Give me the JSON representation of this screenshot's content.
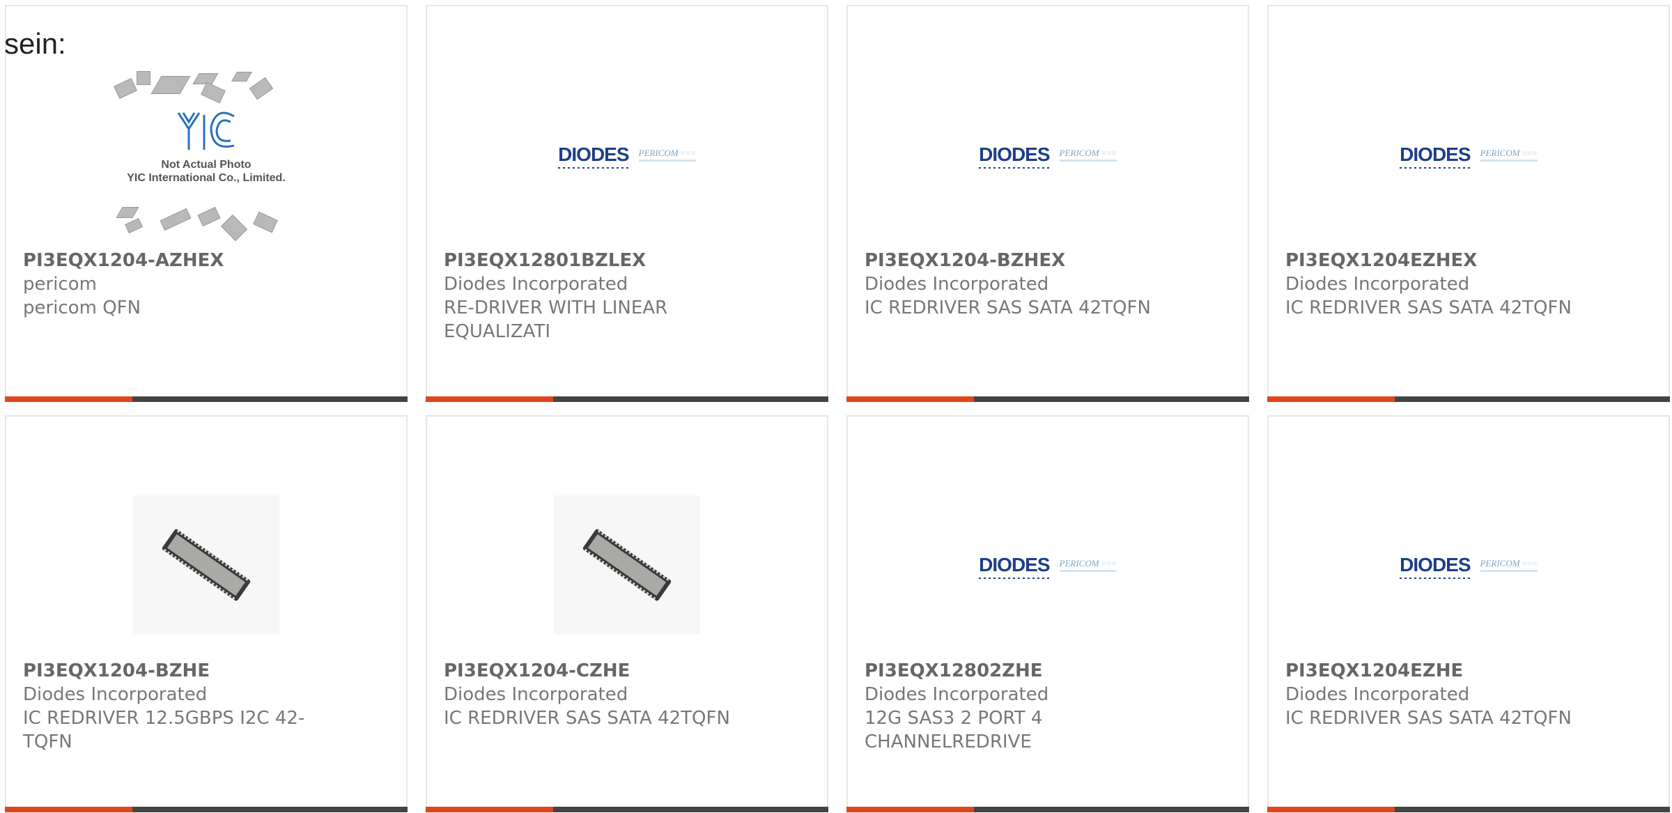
{
  "intro": "sein:",
  "colors": {
    "accent": "#e2461a",
    "bar": "#444444",
    "logo_blue": "#1d3f86"
  },
  "products": [
    {
      "part": "PI3EQX1204-AZHEX",
      "manufacturer": "pericom",
      "description": "pericom QFN",
      "image": "yic-placeholder",
      "image_caption": [
        "Not Actual Photo",
        "YIC International Co., Limited."
      ]
    },
    {
      "part": "PI3EQX12801BZLEX",
      "manufacturer": "Diodes Incorporated",
      "description": "RE-DRIVER WITH LINEAR EQUALIZATI",
      "image": "diodes-logo"
    },
    {
      "part": "PI3EQX1204-BZHEX",
      "manufacturer": "Diodes Incorporated",
      "description": "IC REDRIVER SAS SATA 42TQFN",
      "image": "diodes-logo"
    },
    {
      "part": "PI3EQX1204EZHEX",
      "manufacturer": "Diodes Incorporated",
      "description": "IC REDRIVER SAS SATA 42TQFN",
      "image": "diodes-logo"
    },
    {
      "part": "PI3EQX1204-BZHE",
      "manufacturer": "Diodes Incorporated",
      "description": "IC REDRIVER 12.5GBPS I2C 42-TQFN",
      "image": "qfn-chip"
    },
    {
      "part": "PI3EQX1204-CZHE",
      "manufacturer": "Diodes Incorporated",
      "description": "IC REDRIVER SAS SATA 42TQFN",
      "image": "qfn-chip"
    },
    {
      "part": "PI3EQX12802ZHE",
      "manufacturer": "Diodes Incorporated",
      "description": "12G SAS3 2 PORT 4 CHANNELREDRIVE",
      "image": "diodes-logo"
    },
    {
      "part": "PI3EQX1204EZHE",
      "manufacturer": "Diodes Incorporated",
      "description": "IC REDRIVER SAS SATA 42TQFN",
      "image": "diodes-logo"
    }
  ],
  "logos": {
    "diodes_word": "DIODES",
    "pericom_word": "PERICOM",
    "yic_word": "YIC"
  }
}
